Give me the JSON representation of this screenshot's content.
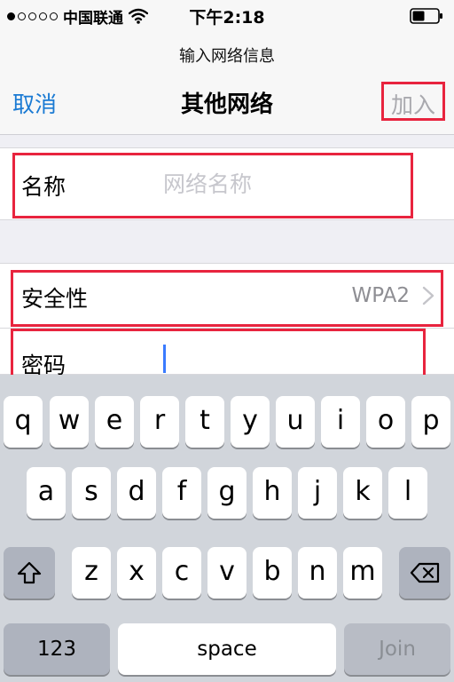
{
  "status_bar": {
    "carrier": "中国联通",
    "time": "下午2:18",
    "signal_bars": 1,
    "signal_total": 5
  },
  "nav": {
    "prompt": "输入网络信息",
    "cancel_label": "取消",
    "title": "其他网络",
    "join_label": "加入"
  },
  "form": {
    "name_label": "名称",
    "name_placeholder": "网络名称",
    "name_value": "",
    "security_label": "安全性",
    "security_value": "WPA2",
    "password_label": "密码",
    "password_value": ""
  },
  "keyboard": {
    "row1": [
      "q",
      "w",
      "e",
      "r",
      "t",
      "y",
      "u",
      "i",
      "o",
      "p"
    ],
    "row2": [
      "a",
      "s",
      "d",
      "f",
      "g",
      "h",
      "j",
      "k",
      "l"
    ],
    "row3": [
      "z",
      "x",
      "c",
      "v",
      "b",
      "n",
      "m"
    ],
    "numbers_label": "123",
    "space_label": "space",
    "join_label": "Join"
  },
  "colors": {
    "accent": "#1a7ad3",
    "highlight": "#e8243e",
    "cursor": "#3a7bff"
  }
}
